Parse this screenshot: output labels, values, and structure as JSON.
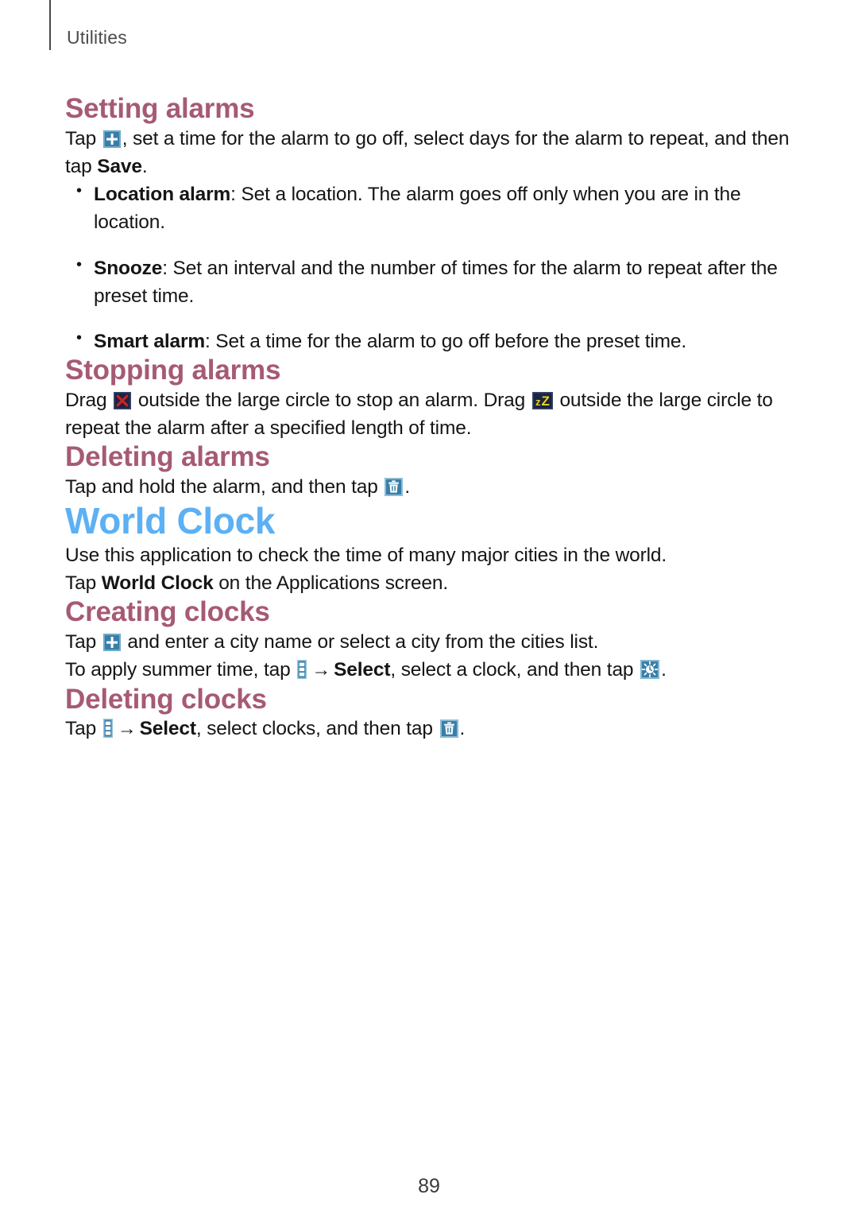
{
  "page": {
    "running_head": "Utilities",
    "number": "89",
    "colors": {
      "section_heading": "#a65a73",
      "chapter_heading": "#5cb0f4",
      "body_text": "#151515",
      "icon_blue": "#3a7ea8",
      "icon_blue_light": "#7fb9d6",
      "icon_navy": "#1b2440",
      "icon_red": "#cf2027",
      "icon_yellow": "#e8d21e",
      "rule": "#4a4a4a"
    }
  },
  "sections": [
    {
      "id": "setting-alarms",
      "heading": "Setting alarms",
      "paragraph_parts": [
        {
          "type": "text",
          "value": "Tap "
        },
        {
          "type": "icon",
          "value": "plus-icon"
        },
        {
          "type": "text",
          "value": ", set a time for the alarm to go off, select days for the alarm to repeat, and then tap "
        },
        {
          "type": "bold",
          "value": "Save"
        },
        {
          "type": "text",
          "value": "."
        }
      ],
      "bullets": [
        {
          "term": "Location alarm",
          "text": ": Set a location. The alarm goes off only when you are in the location."
        },
        {
          "term": "Snooze",
          "text": ": Set an interval and the number of times for the alarm to repeat after the preset time."
        },
        {
          "term": "Smart alarm",
          "text": ": Set a time for the alarm to go off before the preset time."
        }
      ]
    },
    {
      "id": "stopping-alarms",
      "heading": "Stopping alarms",
      "paragraph_parts": [
        {
          "type": "text",
          "value": "Drag "
        },
        {
          "type": "icon",
          "value": "dismiss-x-icon"
        },
        {
          "type": "text",
          "value": " outside the large circle to stop an alarm. Drag "
        },
        {
          "type": "icon",
          "value": "snooze-zz-icon"
        },
        {
          "type": "text",
          "value": " outside the large circle to repeat the alarm after a specified length of time."
        }
      ]
    },
    {
      "id": "deleting-alarms",
      "heading": "Deleting alarms",
      "paragraph_parts": [
        {
          "type": "text",
          "value": "Tap and hold the alarm, and then tap "
        },
        {
          "type": "icon",
          "value": "trash-icon"
        },
        {
          "type": "text",
          "value": "."
        }
      ]
    }
  ],
  "chapter": {
    "title": "World Clock",
    "intro_line_1": "Use this application to check the time of many major cities in the world.",
    "intro_line_2_parts": [
      {
        "type": "text",
        "value": "Tap "
      },
      {
        "type": "bold",
        "value": "World Clock"
      },
      {
        "type": "text",
        "value": " on the Applications screen."
      }
    ],
    "sections": [
      {
        "id": "creating-clocks",
        "heading": "Creating clocks",
        "line_1_parts": [
          {
            "type": "text",
            "value": "Tap "
          },
          {
            "type": "icon",
            "value": "plus-icon"
          },
          {
            "type": "text",
            "value": " and enter a city name or select a city from the cities list."
          }
        ],
        "line_2_parts": [
          {
            "type": "text",
            "value": "To apply summer time, tap "
          },
          {
            "type": "icon",
            "value": "menu-icon"
          },
          {
            "type": "arrow",
            "value": "→"
          },
          {
            "type": "bold",
            "value": "Select"
          },
          {
            "type": "text",
            "value": ", select a clock, and then tap "
          },
          {
            "type": "icon",
            "value": "summer-time-sun-icon"
          },
          {
            "type": "text",
            "value": "."
          }
        ]
      },
      {
        "id": "deleting-clocks",
        "heading": "Deleting clocks",
        "line_1_parts": [
          {
            "type": "text",
            "value": "Tap "
          },
          {
            "type": "icon",
            "value": "menu-icon"
          },
          {
            "type": "arrow",
            "value": "→"
          },
          {
            "type": "bold",
            "value": "Select"
          },
          {
            "type": "text",
            "value": ", select clocks, and then tap "
          },
          {
            "type": "icon",
            "value": "trash-icon"
          },
          {
            "type": "text",
            "value": "."
          }
        ]
      }
    ]
  },
  "text": {
    "setting_heading": "Setting alarms",
    "stopping_heading": "Stopping alarms",
    "deleting_alarms_heading": "Deleting alarms",
    "chapter_title": "World Clock",
    "creating_heading": "Creating clocks",
    "deleting_clocks_heading": "Deleting clocks",
    "save_label": "Save",
    "select_label": "Select",
    "world_clock_label": "World Clock",
    "arrow": "→"
  }
}
